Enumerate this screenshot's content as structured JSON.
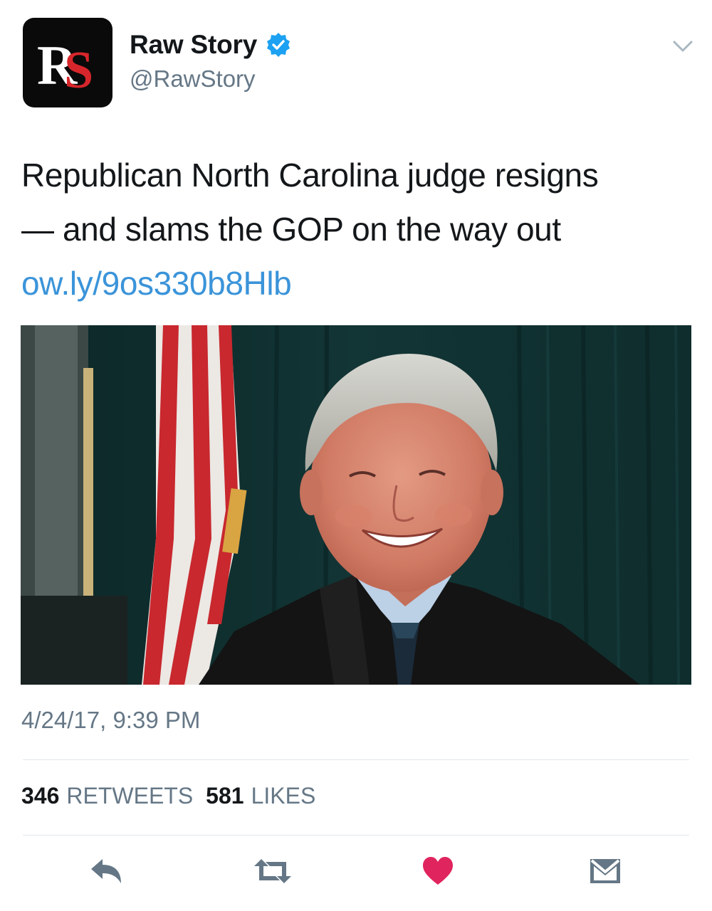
{
  "header": {
    "avatar_text": "RS",
    "display_name": "Raw Story",
    "handle": "@RawStory"
  },
  "tweet": {
    "text_line1": "Republican North Carolina judge resigns",
    "text_line2": "— and slams the GOP on the way out",
    "link": "ow.ly/9os330b8Hlb"
  },
  "timestamp": "4/24/17, 9:39 PM",
  "stats": {
    "retweets_count": "346",
    "retweets_label": "RETWEETS",
    "likes_count": "581",
    "likes_label": "LIKES"
  },
  "actions": {
    "reply_icon": "reply-icon",
    "retweet_icon": "retweet-icon",
    "like_icon": "heart-icon",
    "dm_icon": "envelope-icon"
  },
  "colors": {
    "link": "#3b94d9",
    "verified": "#1da1f2",
    "like": "#e0245e",
    "muted": "#657786"
  }
}
